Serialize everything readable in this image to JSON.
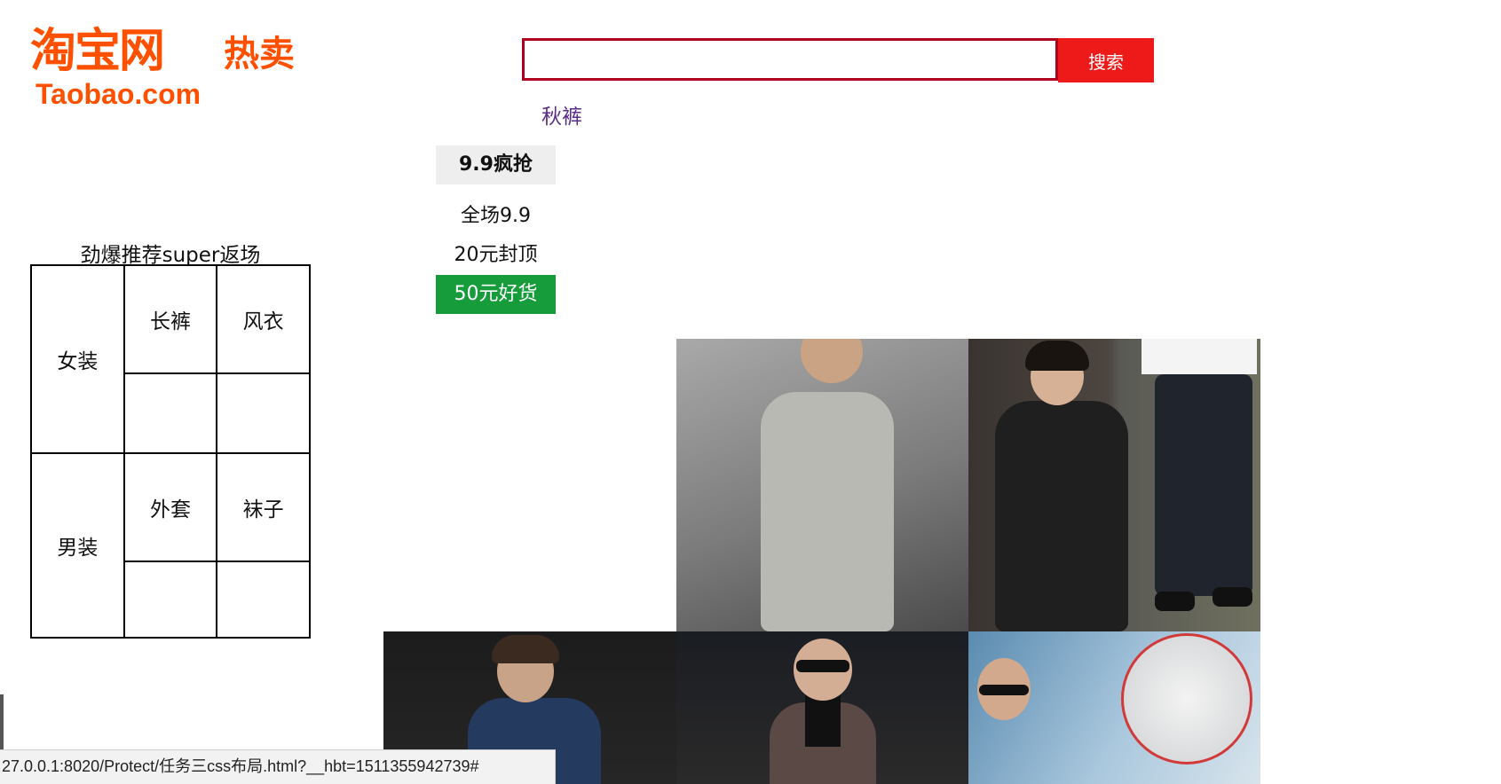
{
  "logo": {
    "main": "淘宝网",
    "sub": "热卖",
    "domain": "Taobao.com"
  },
  "search": {
    "value": "",
    "placeholder": "",
    "button_label": "搜索",
    "hot_link": "秋裤"
  },
  "left_table": {
    "caption": "劲爆推荐super返场",
    "groups": [
      {
        "label": "女装",
        "row1": [
          "长裤",
          "风衣"
        ],
        "row2": [
          "",
          ""
        ]
      },
      {
        "label": "男装",
        "row1": [
          "外套",
          "袜子"
        ],
        "row2": [
          "",
          ""
        ]
      }
    ]
  },
  "menu": {
    "header": "9.9疯抢",
    "items": [
      "全场9.9",
      "20元封顶",
      "50元好货"
    ],
    "active_index": 2
  },
  "status_bar": {
    "url": "27.0.0.1:8020/Protect/任务三css布局.html?__hbt=1511355942739#"
  },
  "colors": {
    "brand": "#ff5000",
    "search_border": "#b0001f",
    "search_button": "#ee1a1a",
    "active_menu": "#169c3a",
    "visited_link": "#5b2d86"
  }
}
